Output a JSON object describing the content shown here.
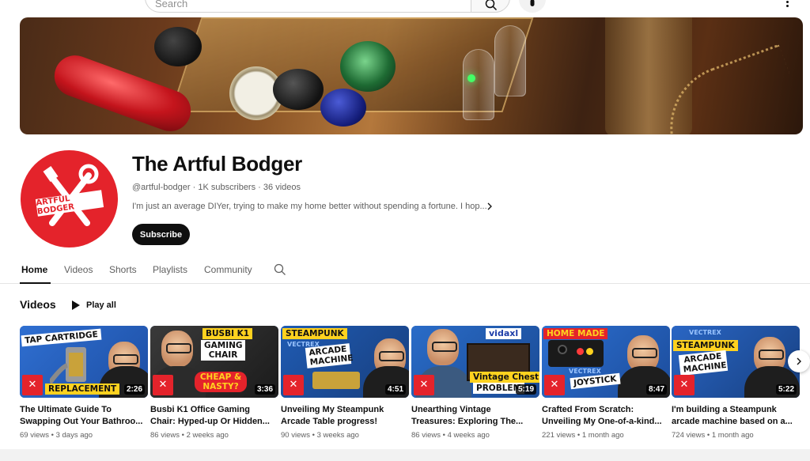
{
  "topbar": {
    "search_placeholder": "Search"
  },
  "channel": {
    "name": "The Artful Bodger",
    "handle": "@artful-bodger",
    "subscribers": "1K subscribers",
    "video_count": "36 videos",
    "separator": "·",
    "description": "I'm just an average DIYer, trying to make my home better without spending a fortune. I hop...",
    "avatar_text": "ARTFUL BODGER",
    "subscribe_label": "Subscribe"
  },
  "tabs": [
    {
      "label": "Home",
      "active": true
    },
    {
      "label": "Videos",
      "active": false
    },
    {
      "label": "Shorts",
      "active": false
    },
    {
      "label": "Playlists",
      "active": false
    },
    {
      "label": "Community",
      "active": false
    }
  ],
  "section": {
    "title": "Videos",
    "play_all": "Play all"
  },
  "videos": [
    {
      "title_line1": "The Ultimate Guide To",
      "title_line2": "Swapping Out Your Bathroo...",
      "views": "69 views",
      "age": "3 days ago",
      "duration": "2:26",
      "tag1": "TAP CARTRIDGE",
      "tag2": "REPLACEMENT"
    },
    {
      "title_line1": "Busbi K1 Office Gaming",
      "title_line2": "Chair: Hyped-up Or Hidden...",
      "views": "86 views",
      "age": "2 weeks ago",
      "duration": "3:36",
      "tag1": "BUSBI K1",
      "tag2": "GAMING CHAIR",
      "tag3": "CHEAP & NASTY?"
    },
    {
      "title_line1": "Unveiling My Steampunk",
      "title_line2": "Arcade Table progress!",
      "views": "90 views",
      "age": "3 weeks ago",
      "duration": "4:51",
      "tag1": "STEAMPUNK",
      "tag2": "ARCADE MACHINE",
      "tag3": "VECTREX"
    },
    {
      "title_line1": "Unearthing Vintage",
      "title_line2": "Treasures: Exploring The...",
      "views": "86 views",
      "age": "4 weeks ago",
      "duration": "5:19",
      "tag1": "vidaxl",
      "tag2": "Vintage Chest",
      "tag3": "PROBLEM"
    },
    {
      "title_line1": "Crafted From Scratch:",
      "title_line2": "Unveiling My One-of-a-kind...",
      "views": "221 views",
      "age": "1 month ago",
      "duration": "8:47",
      "tag1": "HOME MADE",
      "tag2": "JOYSTICK",
      "tag3": "VECTREX"
    },
    {
      "title_line1": "I'm building a Steampunk",
      "title_line2": "arcade machine based on a...",
      "views": "724 views",
      "age": "1 month ago",
      "duration": "5:22",
      "tag1": "STEAMPUNK",
      "tag2": "ARCADE MACHINE",
      "tag3": "VECTREX"
    }
  ],
  "meta_separator": "•",
  "colors": {
    "brand_red": "#e4232b",
    "tag_yellow": "#ffd21f",
    "text_primary": "#0f0f0f",
    "text_secondary": "#606060"
  }
}
